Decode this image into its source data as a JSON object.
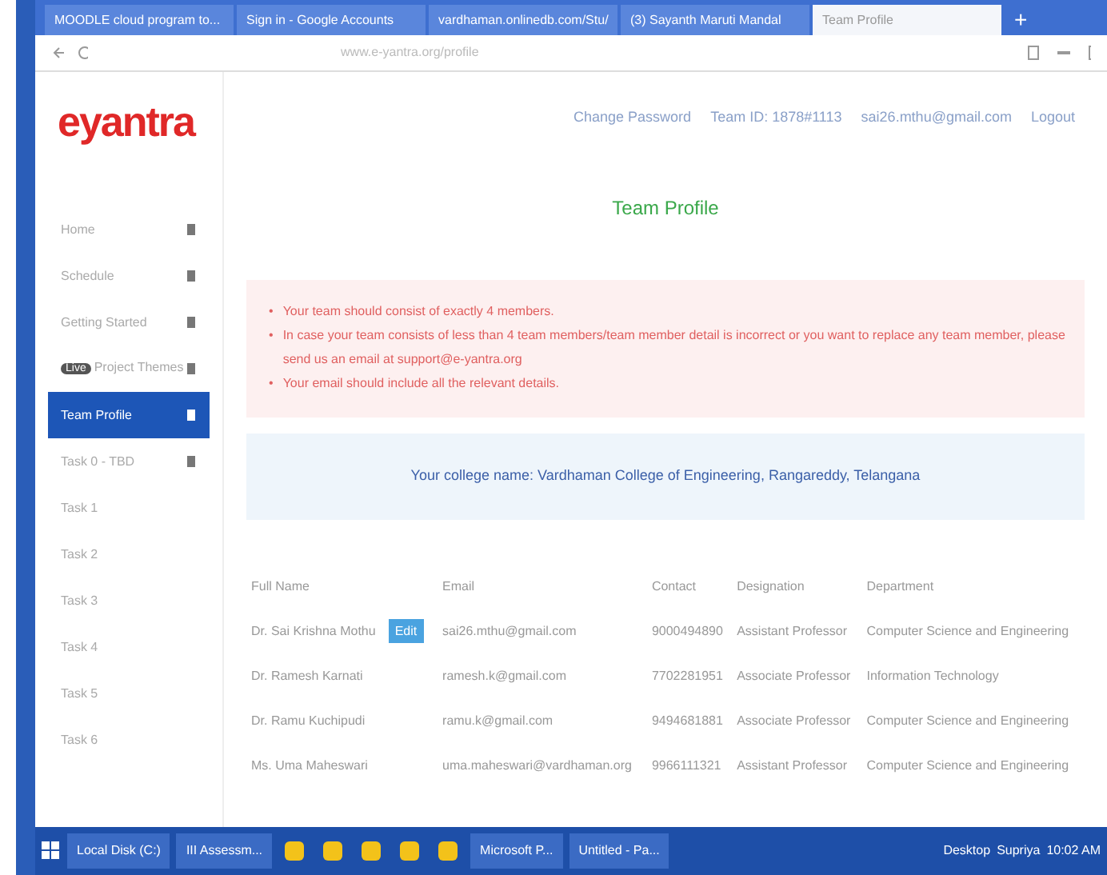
{
  "browser": {
    "tabs": [
      {
        "label": "MOODLE cloud program to...",
        "selected": false
      },
      {
        "label": "Sign in - Google Accounts",
        "selected": false
      },
      {
        "label": "vardhaman.onlinedb.com/Stu/",
        "selected": false
      },
      {
        "label": "(3) Sayanth Maruti Mandal",
        "selected": false
      },
      {
        "label": "Team Profile",
        "selected": true
      }
    ],
    "new_tab": "+",
    "url": "www.e-yantra.org/profile"
  },
  "header": {
    "logo": "eyantra",
    "links": [
      "Change Password",
      "Team ID: 1878#1113",
      "sai26.mthu@gmail.com",
      "Logout"
    ]
  },
  "sidebar": {
    "items": [
      {
        "label": "Home",
        "selected": false
      },
      {
        "label": "Schedule",
        "selected": false
      },
      {
        "label": "Getting Started",
        "selected": false
      },
      {
        "label": "Project Themes",
        "badge": "Live",
        "selected": false
      },
      {
        "label": "Team Profile",
        "selected": true
      },
      {
        "label": "Task 0 - TBD",
        "selected": false
      },
      {
        "label": "Task 1",
        "selected": false
      },
      {
        "label": "Task 2",
        "selected": false
      },
      {
        "label": "Task 3",
        "selected": false
      },
      {
        "label": "Task 4",
        "selected": false
      },
      {
        "label": "Task 5",
        "selected": false
      },
      {
        "label": "Task 6",
        "selected": false
      }
    ]
  },
  "main": {
    "title": "Team Profile",
    "bullet": "•",
    "notes": [
      "Your team should consist of exactly 4 members.",
      "In case your team consists of less than 4 team members/team member detail is incorrect or you want to replace any team member, please send us an email at support@e-yantra.org",
      "Your email should include all the relevant details."
    ],
    "college": "Your college name: Vardhaman College of Engineering, Rangareddy, Telangana",
    "table": {
      "columns": [
        "Full Name",
        "Email",
        "Contact",
        "Designation",
        "Department"
      ],
      "rows": [
        {
          "cells": [
            "Dr. Sai Krishna Mothu",
            "sai26.mthu@gmail.com",
            "9000494890",
            "Assistant Professor",
            "Computer Science and Engineering"
          ],
          "badge": "Edit"
        },
        {
          "cells": [
            "Dr. Ramesh Karnati",
            "ramesh.k@gmail.com",
            "7702281951",
            "Associate Professor",
            "Information Technology"
          ]
        },
        {
          "cells": [
            "Dr. Ramu Kuchipudi",
            "ramu.k@gmail.com",
            "9494681881",
            "Associate Professor",
            "Computer Science and Engineering"
          ]
        },
        {
          "cells": [
            "Ms. Uma Maheswari",
            "uma.maheswari@vardhaman.org",
            "9966111321",
            "Assistant Professor",
            "Computer Science and Engineering"
          ]
        }
      ]
    }
  },
  "taskbar": {
    "items": [
      {
        "label": "Local Disk (C:)",
        "kind": "window"
      },
      {
        "label": "III Assessm...",
        "kind": "window"
      },
      {
        "kind": "pin"
      },
      {
        "kind": "pin"
      },
      {
        "kind": "pin"
      },
      {
        "kind": "pin"
      },
      {
        "kind": "pin"
      },
      {
        "label": "Microsoft P...",
        "kind": "window"
      },
      {
        "label": "Untitled - Pa...",
        "kind": "window"
      }
    ],
    "tray": [
      "Desktop",
      "Supriya"
    ],
    "clock": "10:02 AM"
  }
}
